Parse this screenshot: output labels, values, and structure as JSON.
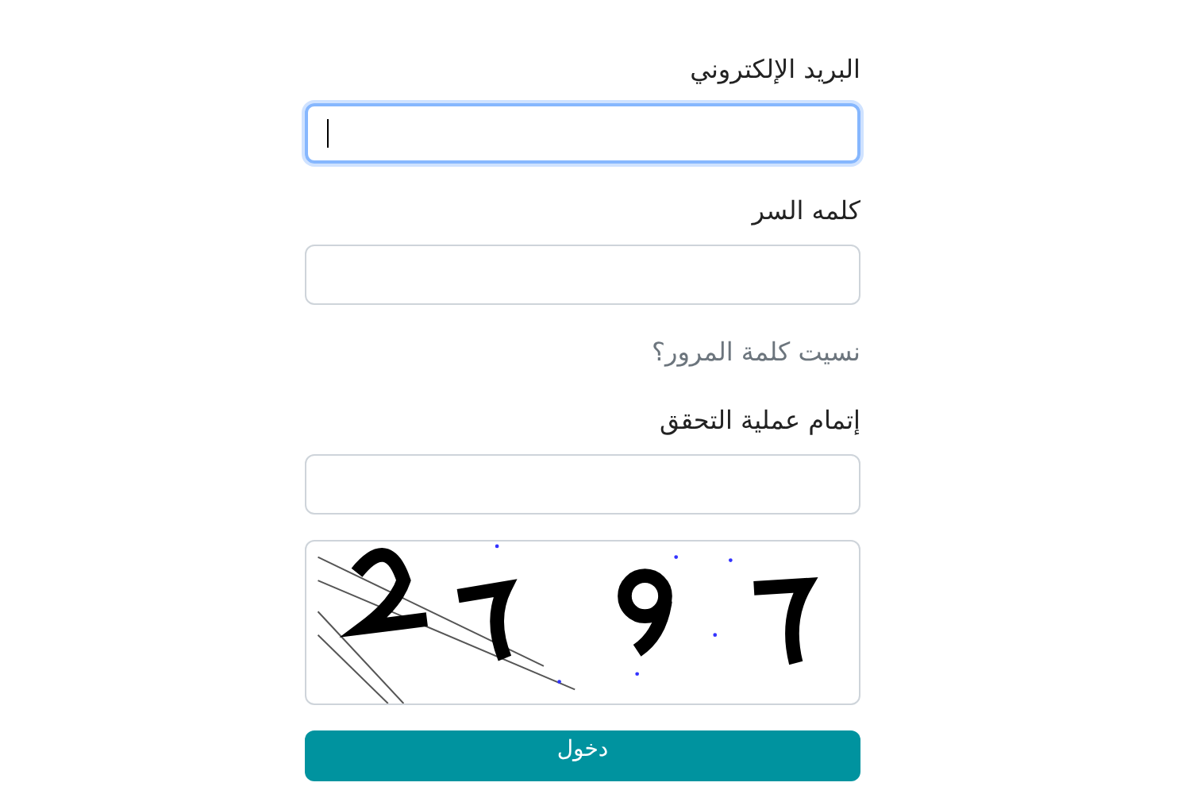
{
  "form": {
    "fields": [
      {
        "label": "البريد الإلكتروني",
        "focused": true
      },
      {
        "label": "كلمه السر",
        "focused": false
      }
    ],
    "forgot_link": "نسيت كلمة المرور؟",
    "captcha": {
      "label": "إتمام عملية التحقق",
      "focused": false
    },
    "submit_button": "دخول"
  }
}
